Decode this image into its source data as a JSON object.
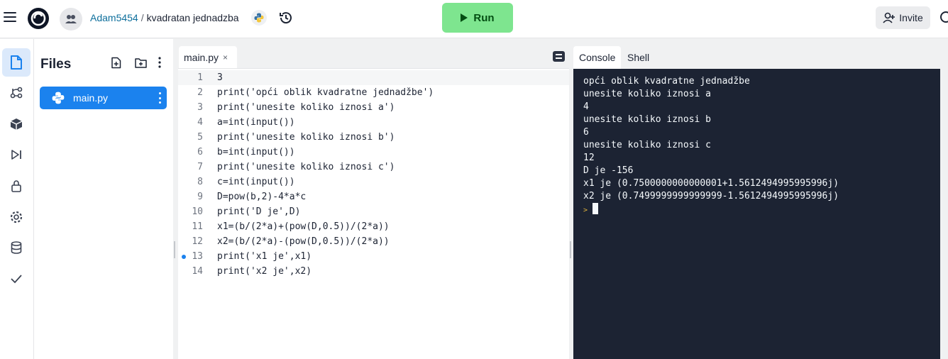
{
  "header": {
    "username": "Adam5454",
    "separator": "/",
    "repl_name": "kvadratan jednadzba",
    "run_label": "Run",
    "invite_label": "Invite"
  },
  "icons": {
    "menu": "hamburger-icon",
    "logo": "replit-logo-icon",
    "avatar": "user-avatar-icon",
    "language": "python-icon",
    "history": "history-icon",
    "run": "play-icon",
    "invite": "add-user-icon"
  },
  "colors": {
    "run_button": "#7ee58f",
    "active_file": "#1b82ee",
    "console_bg": "#1c2333",
    "link": "#0e6f9c"
  },
  "sidebar": {
    "files_title": "Files",
    "files": [
      {
        "name": "main.py"
      }
    ]
  },
  "editor": {
    "tab_label": "main.py",
    "tab_close": "×",
    "lines": [
      {
        "n": "1",
        "code": "3"
      },
      {
        "n": "2",
        "code": "print('opći oblik kvadratne jednadžbe')"
      },
      {
        "n": "3",
        "code": "print('unesite koliko iznosi a')"
      },
      {
        "n": "4",
        "code": "a=int(input())"
      },
      {
        "n": "5",
        "code": "print('unesite koliko iznosi b')"
      },
      {
        "n": "6",
        "code": "b=int(input())"
      },
      {
        "n": "7",
        "code": "print('unesite koliko iznosi c')"
      },
      {
        "n": "8",
        "code": "c=int(input())"
      },
      {
        "n": "9",
        "code": "D=pow(b,2)-4*a*c"
      },
      {
        "n": "10",
        "code": "print('D je',D)"
      },
      {
        "n": "11",
        "code": "x1=(b/(2*a)+(pow(D,0.5))/(2*a))"
      },
      {
        "n": "12",
        "code": "x2=(b/(2*a)-(pow(D,0.5))/(2*a))"
      },
      {
        "n": "13",
        "code": "print('x1 je',x1)"
      },
      {
        "n": "14",
        "code": "print('x2 je',x2)"
      }
    ]
  },
  "console": {
    "tab_console": "Console",
    "tab_shell": "Shell",
    "prompt": ">",
    "output": [
      "opći oblik kvadratne jednadžbe",
      "unesite koliko iznosi a",
      "4",
      "unesite koliko iznosi b",
      "6",
      "unesite koliko iznosi c",
      "12",
      "D je -156",
      "x1 je (0.7500000000000001+1.5612494995995996j)",
      "x2 je (0.7499999999999999-1.5612494995995996j)"
    ]
  }
}
